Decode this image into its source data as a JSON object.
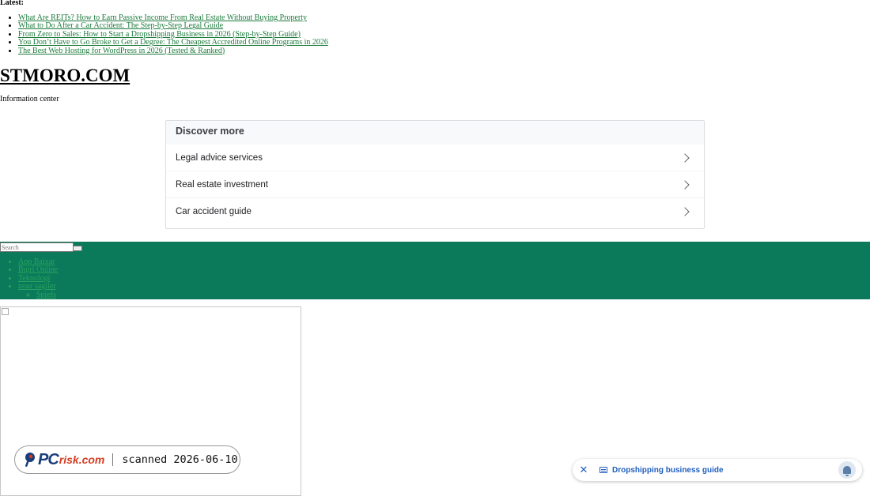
{
  "latest": {
    "label": "Latest:",
    "items": [
      "What Are REITs? How to Earn Passive Income From Real Estate Without Buying Property",
      "What to Do After a Car Accident: The Step-by-Step Legal Guide",
      "From Zero to Sales: How to Start a Dropshipping Business in 2026 (Step-by-Step Guide)",
      "You Don’t Have to Go Broke to Get a Degree: The Cheapest Accredited Online Programs in 2026",
      "The Best Web Hosting for WordPress in 2026 (Tested & Ranked)"
    ]
  },
  "site": {
    "title": "STMORO.COM",
    "tagline": "Information center"
  },
  "discover": {
    "heading": "Discover more",
    "items": [
      "Legal advice services",
      "Real estate investment",
      "Car accident guide"
    ]
  },
  "search": {
    "placeholder": "Search"
  },
  "nav": {
    "items": [
      "App Baixar",
      "Bujri Online",
      "Teknologi",
      "nour sagiler"
    ],
    "subitems": [
      "Spiefs"
    ]
  },
  "badge": {
    "logo_pc": "PC",
    "logo_domain": "risk.com",
    "text": "scanned 2026-06-10"
  },
  "notification": {
    "close_symbol": "✕",
    "text": "Dropshipping business guide"
  },
  "colors": {
    "nav_band": "#0b7a5a",
    "link": "#1a7a3a",
    "notification_accent": "#1f5fbf"
  }
}
